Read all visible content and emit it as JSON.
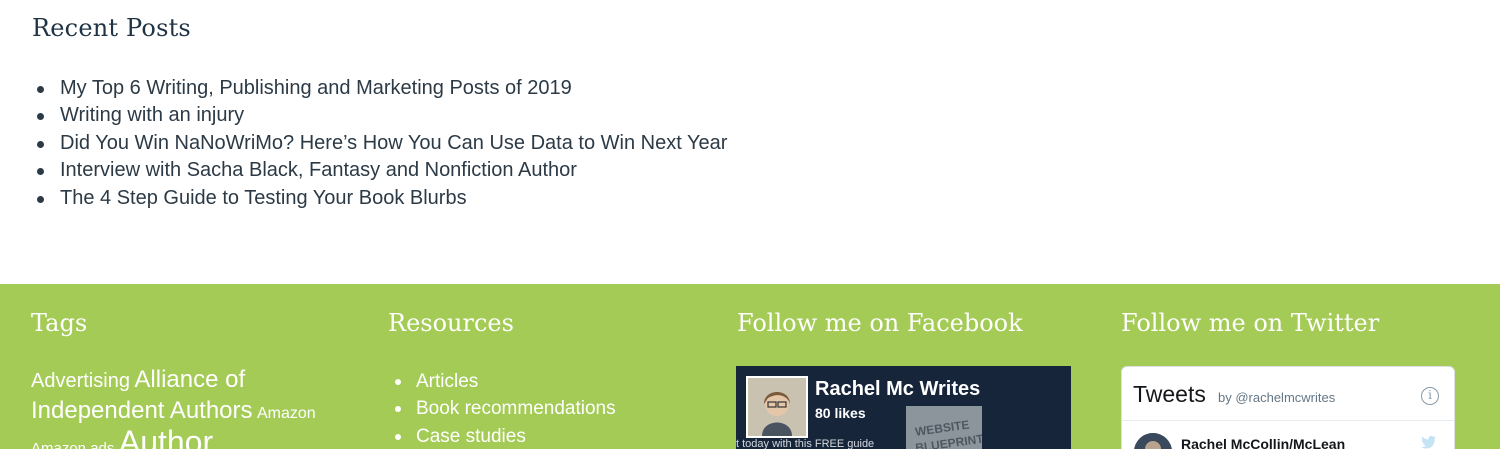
{
  "recent_posts": {
    "title": "Recent Posts",
    "items": [
      "My Top 6 Writing, Publishing and Marketing Posts of 2019",
      "Writing with an injury",
      "Did You Win NaNoWriMo? Here’s How You Can Use Data to Win Next Year",
      "Interview with Sacha Black, Fantasy and Nonfiction Author",
      "The 4 Step Guide to Testing Your Book Blurbs"
    ]
  },
  "footer": {
    "background": "#a3cb56",
    "tags": {
      "title": "Tags",
      "items": [
        "Advertising",
        "Alliance of Independent Authors",
        "Amazon",
        "Amazon ads",
        "Author"
      ]
    },
    "resources": {
      "title": "Resources",
      "items": [
        "Articles",
        "Book recommendations",
        "Case studies"
      ]
    },
    "facebook": {
      "title": "Follow me on Facebook",
      "page_name": "Rachel Mc Writes",
      "likes": "80 likes",
      "banner_text": "t today with this FREE guide",
      "book_text": [
        "WEBSITE",
        "BLUEPRINT"
      ]
    },
    "twitter": {
      "title": "Follow me on Twitter",
      "widget_title": "Tweets",
      "by_text": "by @rachelmcwrites",
      "info_icon": "i",
      "user_name": "Rachel McCollin/McLean"
    }
  }
}
